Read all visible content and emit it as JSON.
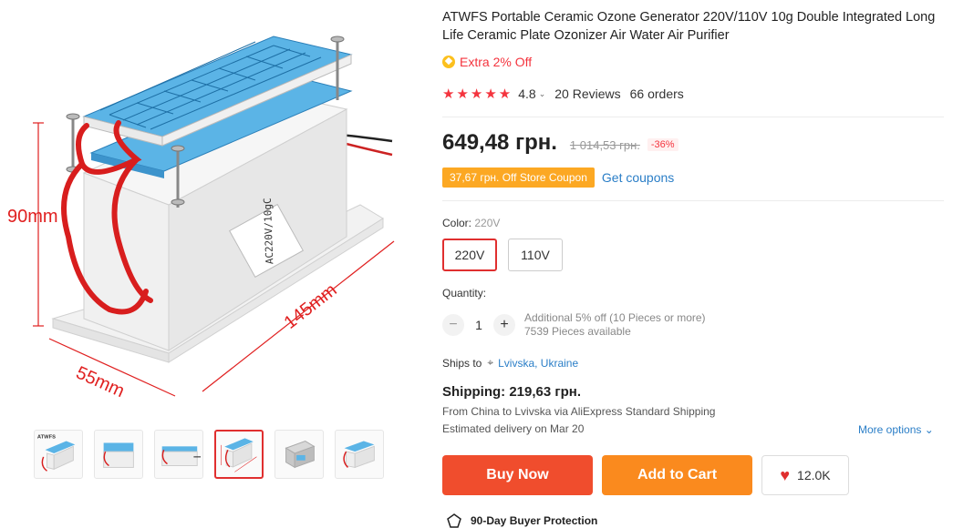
{
  "gallery": {
    "main_image": {
      "dimension_height": "90mm",
      "dimension_width": "55mm",
      "dimension_length": "145mm",
      "label": "AC220V/10gC"
    },
    "thumbnails": [
      {
        "name": "thumb-1",
        "label": "ATWFS"
      },
      {
        "name": "thumb-2"
      },
      {
        "name": "thumb-3"
      },
      {
        "name": "thumb-4",
        "active": true
      },
      {
        "name": "thumb-5"
      },
      {
        "name": "thumb-6"
      }
    ]
  },
  "product": {
    "title": "ATWFS Portable Ceramic Ozone Generator 220V/110V 10g Double Integrated Long Life Ceramic Plate Ozonizer Air Water Air Purifier",
    "extra_off": "Extra 2% Off",
    "stars": "★★★★★",
    "rating": "4.8",
    "reviews": "20 Reviews",
    "orders": "66 orders"
  },
  "price": {
    "current": "649,48 грн.",
    "original": "1 014,53 грн.",
    "discount": "-36%"
  },
  "coupon": {
    "label": "37,67 грн. Off Store Coupon",
    "get_coupons": "Get coupons"
  },
  "color": {
    "label": "Color: ",
    "selected": "220V",
    "options": [
      "220V",
      "110V"
    ]
  },
  "quantity": {
    "label": "Quantity:",
    "minus": "−",
    "value": "1",
    "plus": "+",
    "note1": "Additional 5% off (10 Pieces or more)",
    "note2": "7539 Pieces available"
  },
  "shipping": {
    "ships_to_label": "Ships to",
    "location": "Lvivska, Ukraine",
    "cost": "Shipping: 219,63 грн.",
    "from": "From China to Lvivska via AliExpress Standard Shipping",
    "delivery": "Estimated delivery on Mar 20",
    "more_options": "More options"
  },
  "actions": {
    "buy_now": "Buy Now",
    "add_to_cart": "Add to Cart",
    "wishlist_count": "12.0K"
  },
  "protection": {
    "label": "90-Day Buyer Protection"
  },
  "colors": {
    "accent_red": "#f04d2d",
    "cart_orange": "#fa8a1e",
    "coupon_orange": "#fca823",
    "link_blue": "#2a7ec7",
    "plate_blue": "#5bb4e6"
  }
}
